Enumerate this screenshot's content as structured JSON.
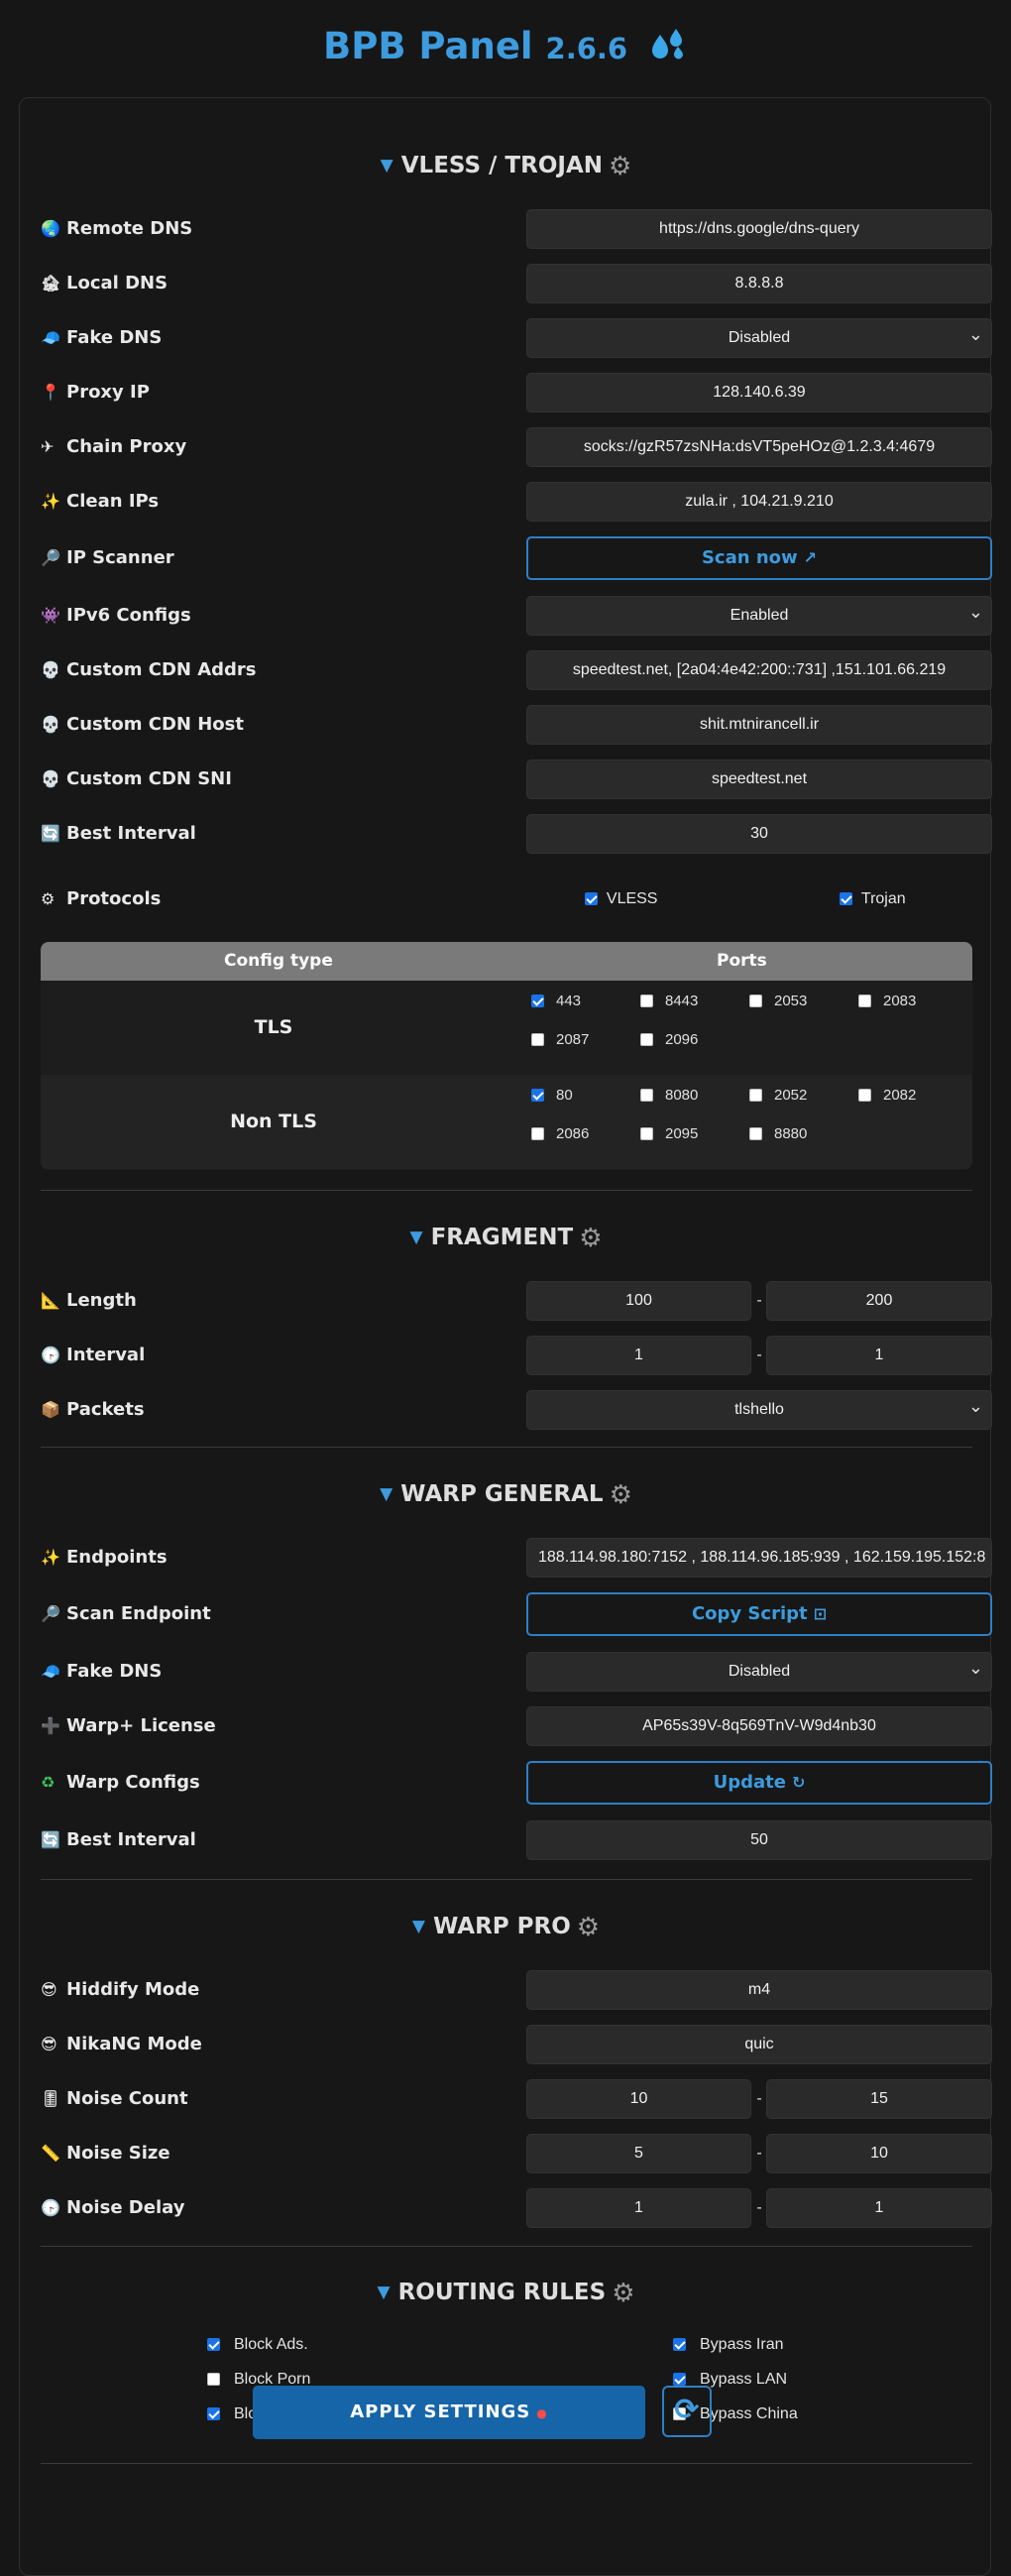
{
  "header": {
    "title": "BPB Panel",
    "version": "2.6.6"
  },
  "vless": {
    "title": "VLESS / TROJAN",
    "rows": [
      {
        "icon": "🌏",
        "label": "Remote DNS",
        "value": "https://dns.google/dns-query"
      },
      {
        "icon": "🏚",
        "label": "Local DNS",
        "value": "8.8.8.8"
      },
      {
        "icon": "🧢",
        "label": "Fake DNS",
        "value": "Disabled"
      },
      {
        "icon": "📍",
        "label": "Proxy IP",
        "value": "128.140.6.39"
      },
      {
        "icon": "✈",
        "label": "Chain Proxy",
        "value": "socks://gzR57zsNHa:dsVT5peHOz@1.2.3.4:4679"
      },
      {
        "icon": "✨",
        "label": "Clean IPs",
        "value": "zula.ir , 104.21.9.210"
      },
      {
        "icon": "🔎",
        "label": "IP Scanner",
        "value": "Scan now"
      },
      {
        "icon": "👾",
        "label": "IPv6 Configs",
        "value": "Enabled"
      },
      {
        "icon": "💀",
        "label": "Custom CDN Addrs",
        "value": "speedtest.net, [2a04:4e42:200::731] ,151.101.66.219"
      },
      {
        "icon": "💀",
        "label": "Custom CDN Host",
        "value": "shit.mtnirancell.ir"
      },
      {
        "icon": "💀",
        "label": "Custom CDN SNI",
        "value": "speedtest.net"
      },
      {
        "icon": "🔄",
        "label": "Best Interval",
        "value": "30"
      }
    ],
    "protocols": {
      "icon": "⚙",
      "label": "Protocols",
      "vless": "VLESS",
      "trojan": "Trojan"
    },
    "ports_table": {
      "col1": "Config type",
      "col2": "Ports",
      "tls_label": "TLS",
      "tls_ports": [
        {
          "port": "443",
          "checked": true
        },
        {
          "port": "8443",
          "checked": false
        },
        {
          "port": "2053",
          "checked": false
        },
        {
          "port": "2083",
          "checked": false
        },
        {
          "port": "2087",
          "checked": false
        },
        {
          "port": "2096",
          "checked": false
        }
      ],
      "nontls_label": "Non TLS",
      "nontls_ports": [
        {
          "port": "80",
          "checked": true
        },
        {
          "port": "8080",
          "checked": false
        },
        {
          "port": "2052",
          "checked": false
        },
        {
          "port": "2082",
          "checked": false
        },
        {
          "port": "2086",
          "checked": false
        },
        {
          "port": "2095",
          "checked": false
        },
        {
          "port": "8880",
          "checked": false
        }
      ]
    }
  },
  "fragment": {
    "title": "FRAGMENT",
    "length": {
      "icon": "📐",
      "label": "Length",
      "min": "100",
      "max": "200"
    },
    "interval": {
      "icon": "🕞",
      "label": "Interval",
      "min": "1",
      "max": "1"
    },
    "packets": {
      "icon": "📦",
      "label": "Packets",
      "value": "tlshello"
    }
  },
  "warp_general": {
    "title": "WARP GENERAL",
    "endpoints": {
      "icon": "✨",
      "label": "Endpoints",
      "value": "188.114.98.180:7152 , 188.114.96.185:939 , 162.159.195.152:8"
    },
    "scan_endpoint": {
      "icon": "🔎",
      "label": "Scan Endpoint",
      "value": "Copy Script"
    },
    "fake_dns": {
      "icon": "🧢",
      "label": "Fake DNS",
      "value": "Disabled"
    },
    "license": {
      "icon": "➕",
      "label": "Warp+ License",
      "value": "AP65s39V-8q569TnV-W9d4nb30"
    },
    "configs": {
      "icon": "♻",
      "label": "Warp Configs",
      "value": "Update"
    },
    "best_interval": {
      "icon": "🔄",
      "label": "Best Interval",
      "value": "50"
    }
  },
  "warp_pro": {
    "title": "WARP PRO",
    "hiddify": {
      "icon": "😎",
      "label": "Hiddify Mode",
      "value": "m4"
    },
    "nikang": {
      "icon": "😎",
      "label": "NikaNG Mode",
      "value": "quic"
    },
    "noise_count": {
      "icon": "🎚",
      "label": "Noise Count",
      "min": "10",
      "max": "15"
    },
    "noise_size": {
      "icon": "📏",
      "label": "Noise Size",
      "min": "5",
      "max": "10"
    },
    "noise_delay": {
      "icon": "🕞",
      "label": "Noise Delay",
      "min": "1",
      "max": "1"
    }
  },
  "routing": {
    "title": "ROUTING RULES",
    "left": [
      {
        "label": "Block Ads.",
        "checked": true
      },
      {
        "label": "Block Porn",
        "checked": false
      },
      {
        "label": "Block QUIC",
        "checked": true
      }
    ],
    "right": [
      {
        "label": "Bypass Iran",
        "checked": true
      },
      {
        "label": "Bypass LAN",
        "checked": true
      },
      {
        "label": "Bypass China",
        "checked": false
      }
    ]
  },
  "footer": {
    "apply_label": "APPLY SETTINGS",
    "refresh_icon": "refresh-icon"
  },
  "colors": {
    "accent": "#3d9bde",
    "apply_bg": "#1565a8",
    "field_bg": "#2a2a2a",
    "background": "#161616"
  }
}
